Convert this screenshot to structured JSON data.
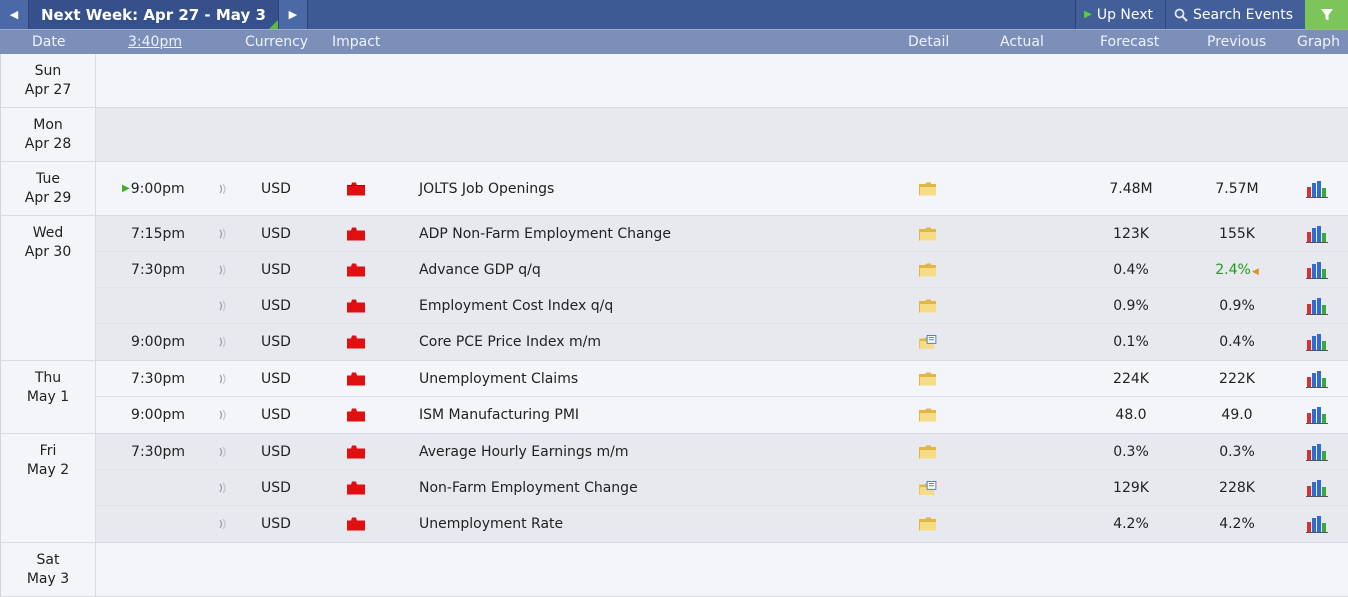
{
  "topbar": {
    "prev_arrow": "◀",
    "week_label": "Next Week: Apr 27 - May 3",
    "next_arrow": "▶",
    "up_next": "Up Next",
    "search_events": "Search Events"
  },
  "columns": {
    "date": "Date",
    "time": "3:40pm",
    "currency": "Currency",
    "impact": "Impact",
    "detail": "Detail",
    "actual": "Actual",
    "forecast": "Forecast",
    "previous": "Previous",
    "graph": "Graph"
  },
  "colors": {
    "header_bg": "#3d5a94",
    "column_bg": "#7b8fb8",
    "high_impact": "#e01010",
    "filter_btn": "#7cc55a",
    "previous_better": "#1f9a1f"
  },
  "days": [
    {
      "weekday": "Sun",
      "date": "Apr 27",
      "events": []
    },
    {
      "weekday": "Mon",
      "date": "Apr 28",
      "events": []
    },
    {
      "weekday": "Tue",
      "date": "Apr 29",
      "events": [
        {
          "time": "9:00pm",
          "currency": "USD",
          "impact": "high-impact-red-folder",
          "name": "JOLTS Job Openings",
          "actual": "",
          "forecast": "7.48M",
          "previous": "7.57M"
        }
      ]
    },
    {
      "weekday": "Wed",
      "date": "Apr 30",
      "events": [
        {
          "time": "7:15pm",
          "currency": "USD",
          "impact": "high-impact-red-folder",
          "name": "ADP Non-Farm Employment Change",
          "actual": "",
          "forecast": "123K",
          "previous": "155K"
        },
        {
          "time": "7:30pm",
          "currency": "USD",
          "impact": "high-impact-red-folder",
          "name": "Advance GDP q/q",
          "actual": "",
          "forecast": "0.4%",
          "previous": "2.4%"
        },
        {
          "time": "",
          "currency": "USD",
          "impact": "high-impact-red-folder",
          "name": "Employment Cost Index q/q",
          "actual": "",
          "forecast": "0.9%",
          "previous": "0.9%"
        },
        {
          "time": "9:00pm",
          "currency": "USD",
          "impact": "high-impact-red-folder",
          "name": "Core PCE Price Index m/m",
          "actual": "",
          "forecast": "0.1%",
          "previous": "0.4%"
        }
      ]
    },
    {
      "weekday": "Thu",
      "date": "May 1",
      "events": [
        {
          "time": "7:30pm",
          "currency": "USD",
          "impact": "high-impact-red-folder",
          "name": "Unemployment Claims",
          "actual": "",
          "forecast": "224K",
          "previous": "222K"
        },
        {
          "time": "9:00pm",
          "currency": "USD",
          "impact": "high-impact-red-folder",
          "name": "ISM Manufacturing PMI",
          "actual": "",
          "forecast": "48.0",
          "previous": "49.0"
        }
      ]
    },
    {
      "weekday": "Fri",
      "date": "May 2",
      "events": [
        {
          "time": "7:30pm",
          "currency": "USD",
          "impact": "high-impact-red-folder",
          "name": "Average Hourly Earnings m/m",
          "actual": "",
          "forecast": "0.3%",
          "previous": "0.3%"
        },
        {
          "time": "",
          "currency": "USD",
          "impact": "high-impact-red-folder",
          "name": "Non-Farm Employment Change",
          "actual": "",
          "forecast": "129K",
          "previous": "228K"
        },
        {
          "time": "",
          "currency": "USD",
          "impact": "high-impact-red-folder",
          "name": "Unemployment Rate",
          "actual": "",
          "forecast": "4.2%",
          "previous": "4.2%"
        }
      ]
    },
    {
      "weekday": "Sat",
      "date": "May 3",
      "events": []
    }
  ]
}
